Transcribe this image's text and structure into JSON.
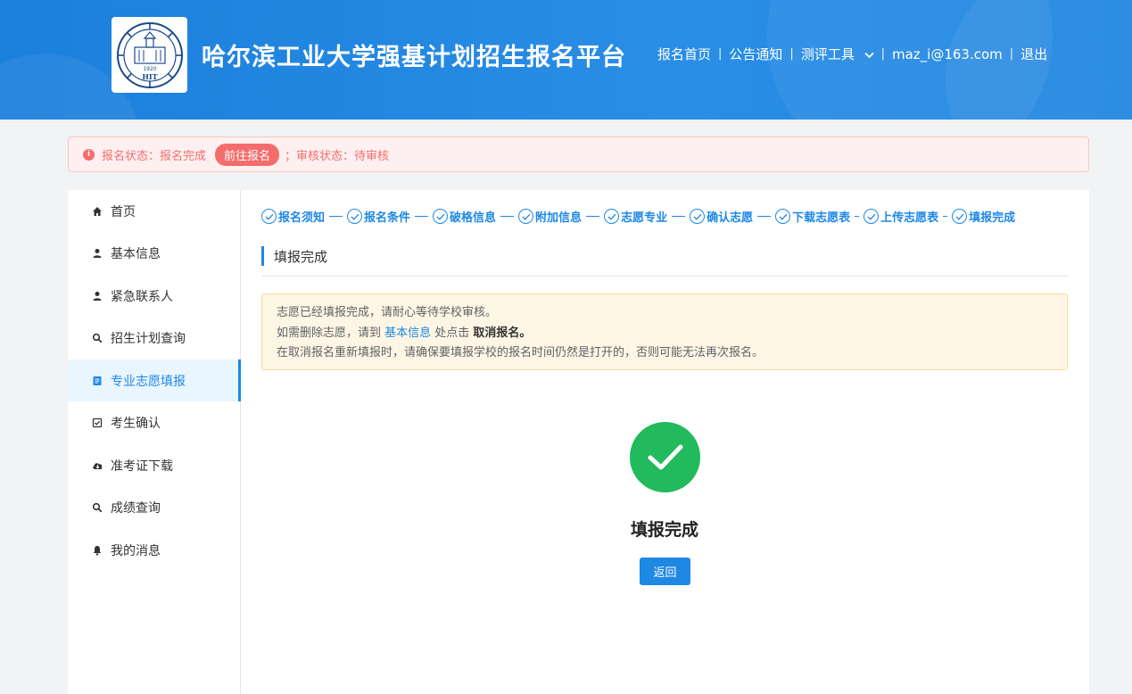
{
  "header": {
    "title": "哈尔滨工业大学强基计划招生报名平台",
    "logo_text": "HIT",
    "logo_year": "1920",
    "nav": {
      "home": "报名首页",
      "notice": "公告通知",
      "tools": "测评工具",
      "user": "maz_i@163.com",
      "logout": "退出"
    }
  },
  "alert": {
    "status_prefix": "报名状态：报名完成",
    "goto_button": "前往报名",
    "review_status": "；审核状态：待审核"
  },
  "sidebar": {
    "items": [
      {
        "label": "首页",
        "icon": "home-icon"
      },
      {
        "label": "基本信息",
        "icon": "user-icon"
      },
      {
        "label": "紧急联系人",
        "icon": "user-icon"
      },
      {
        "label": "招生计划查询",
        "icon": "search-icon"
      },
      {
        "label": "专业志愿填报",
        "icon": "form-icon"
      },
      {
        "label": "考生确认",
        "icon": "checkbox-icon"
      },
      {
        "label": "准考证下载",
        "icon": "cloud-download-icon"
      },
      {
        "label": "成绩查询",
        "icon": "search-icon"
      },
      {
        "label": "我的消息",
        "icon": "bell-icon"
      }
    ],
    "active_index": 4
  },
  "steps": [
    {
      "label": "报名须知"
    },
    {
      "label": "报名条件"
    },
    {
      "label": "破格信息"
    },
    {
      "label": "附加信息"
    },
    {
      "label": "志愿专业"
    },
    {
      "label": "确认志愿"
    },
    {
      "label": "下载志愿表"
    },
    {
      "label": "上传志愿表"
    },
    {
      "label": "填报完成"
    }
  ],
  "section_title": "填报完成",
  "notice": {
    "line1": "志愿已经填报完成，请耐心等待学校审核。",
    "line2_prefix": "如需删除志愿，请到 ",
    "line2_link": "基本信息",
    "line2_middle": " 处点击 ",
    "line2_bold": "取消报名。",
    "line3": "在取消报名重新填报时，请确保要填报学校的报名时间仍然是打开的，否则可能无法再次报名。"
  },
  "result": {
    "title": "填报完成",
    "back_button": "返回"
  },
  "colors": {
    "primary": "#1e88e5",
    "success": "#21ba5c",
    "danger": "#f56c6c",
    "warning_bg": "#fdf6e4"
  }
}
